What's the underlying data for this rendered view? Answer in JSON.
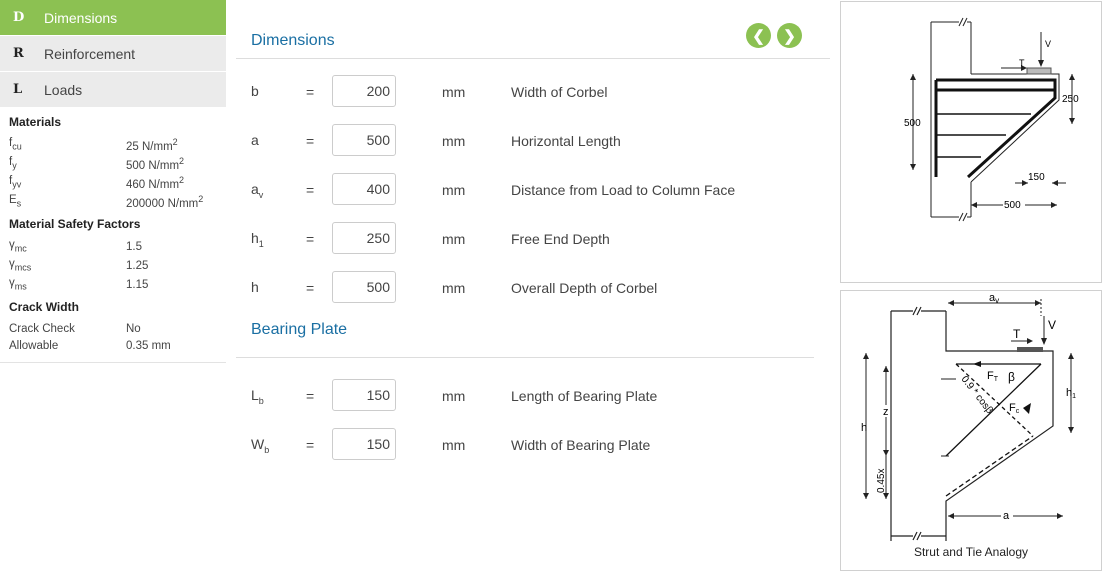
{
  "sidebar": {
    "items": [
      {
        "letter": "D",
        "label": "Dimensions"
      },
      {
        "letter": "R",
        "label": "Reinforcement"
      },
      {
        "letter": "L",
        "label": "Loads"
      }
    ],
    "materials": {
      "title": "Materials",
      "fcu": {
        "value": "25 N/mm"
      },
      "fy": {
        "value": "500 N/mm"
      },
      "fyv": {
        "value": "460 N/mm"
      },
      "Es": {
        "value": "200000 N/mm"
      }
    },
    "safety": {
      "title": "Material Safety Factors",
      "ymc": "1.5",
      "ymcs": "1.25",
      "yms": "1.15"
    },
    "crack": {
      "title": "Crack Width",
      "check_label": "Crack Check",
      "check_value": "No",
      "allow_label": "Allowable",
      "allow_value": "0.35 mm"
    }
  },
  "main": {
    "dimensions_title": "Dimensions",
    "bearing_title": "Bearing Plate",
    "eq": "=",
    "unit": "mm",
    "rows": {
      "b": {
        "value": "200",
        "desc": "Width of Corbel"
      },
      "a": {
        "value": "500",
        "desc": "Horizontal Length"
      },
      "av": {
        "value": "400",
        "desc": "Distance from Load to Column Face"
      },
      "h1": {
        "value": "250",
        "desc": "Free End Depth"
      },
      "h": {
        "value": "500",
        "desc": "Overall Depth of Corbel"
      },
      "Lb": {
        "value": "150",
        "desc": "Length of Bearing Plate"
      },
      "Wb": {
        "value": "150",
        "desc": "Width of Bearing Plate"
      }
    }
  },
  "figure1": {
    "labels": {
      "V": "V",
      "T": "T",
      "d250": "250",
      "d500": "500",
      "d150": "150",
      "dim500b": "500"
    }
  },
  "figure2": {
    "caption": "Strut and Tie Analogy",
    "labels": {
      "T": "T",
      "V": "V",
      "h": "h",
      "z": "z",
      "h1": "h",
      "a": "a",
      "beta": "β",
      "strut": "0.9 * cosβ",
      "x045": "0.45x"
    }
  },
  "colors": {
    "accent": "#8cc152",
    "title": "#1a6fa3"
  }
}
